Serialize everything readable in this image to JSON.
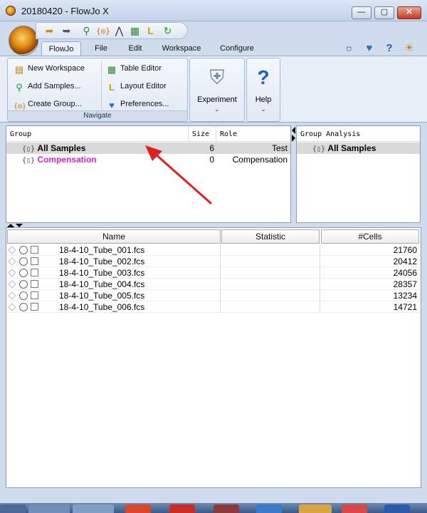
{
  "window": {
    "title": "20180420 - FlowJo X",
    "min_glyph": "—",
    "max_glyph": "▢",
    "close_glyph": "✕"
  },
  "tabs": [
    "FlowJo",
    "File",
    "Edit",
    "Workspace",
    "Configure"
  ],
  "quick_access_icons": [
    "folder-open-icon",
    "redo-icon",
    "gate-tool-icon",
    "group-icon",
    "histogram-icon",
    "table-icon",
    "layout-icon",
    "refresh-icon"
  ],
  "ribbon_right_icons": [
    "ribbon-awareness-icon",
    "heart-icon",
    "help-question-icon",
    "sun-settings-icon"
  ],
  "navigate": {
    "label": "Navigate",
    "new_workspace": "New Workspace",
    "add_samples": "Add Samples...",
    "create_group": "Create Group...",
    "table_editor": "Table Editor",
    "layout_editor": "Layout Editor",
    "preferences": "Preferences..."
  },
  "experiment": {
    "label": "Experiment",
    "chevron": "⌄"
  },
  "help": {
    "label": "Help",
    "chevron": "⌄"
  },
  "groups_panel": {
    "columns": [
      "Group",
      "Size",
      "Role"
    ],
    "rows": [
      {
        "name": "All Samples",
        "size": "6",
        "role": "Test",
        "color": "#000000"
      },
      {
        "name": "Compensation",
        "size": "0",
        "role": "Compensation",
        "color": "#d81fd2"
      }
    ]
  },
  "analysis_panel": {
    "header": "Group Analysis",
    "item": "All Samples"
  },
  "group_icon_glyph": "{▯}",
  "samples_table": {
    "columns": [
      "Name",
      "Statistic",
      "#Cells"
    ],
    "rows": [
      {
        "name": "18-4-10_Tube_001.fcs",
        "statistic": "",
        "cells": "21760"
      },
      {
        "name": "18-4-10_Tube_002.fcs",
        "statistic": "",
        "cells": "20412"
      },
      {
        "name": "18-4-10_Tube_003.fcs",
        "statistic": "",
        "cells": "24056"
      },
      {
        "name": "18-4-10_Tube_004.fcs",
        "statistic": "",
        "cells": "28357"
      },
      {
        "name": "18-4-10_Tube_005.fcs",
        "statistic": "",
        "cells": "13234"
      },
      {
        "name": "18-4-10_Tube_006.fcs",
        "statistic": "",
        "cells": "14721"
      }
    ]
  },
  "colors": {
    "annotation_arrow": "#e02020",
    "compensation_text": "#d81fd2",
    "selected_row": "#d9d9d9"
  }
}
